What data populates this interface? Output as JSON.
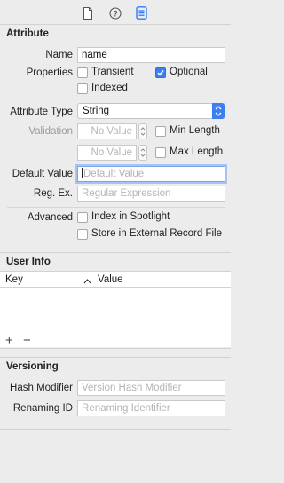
{
  "toolbar": {
    "tabs": [
      {
        "icon": "file-inspector-icon"
      },
      {
        "icon": "quick-help-icon"
      },
      {
        "icon": "data-model-inspector-icon"
      }
    ]
  },
  "attribute": {
    "header": "Attribute",
    "name_label": "Name",
    "name_value": "name",
    "properties_label": "Properties",
    "transient": {
      "label": "Transient",
      "checked": false
    },
    "optional": {
      "label": "Optional",
      "checked": true
    },
    "indexed": {
      "label": "Indexed",
      "checked": false
    },
    "type_label": "Attribute Type",
    "type_value": "String",
    "validation_label": "Validation",
    "min_placeholder": "No Value",
    "max_placeholder": "No Value",
    "min_length": {
      "label": "Min Length",
      "checked": false
    },
    "max_length": {
      "label": "Max Length",
      "checked": false
    },
    "default_label": "Default Value",
    "default_placeholder": "Default Value",
    "regex_label": "Reg. Ex.",
    "regex_placeholder": "Regular Expression",
    "advanced_label": "Advanced",
    "spotlight": {
      "label": "Index in Spotlight",
      "checked": false
    },
    "external": {
      "label": "Store in External Record File",
      "checked": false
    }
  },
  "user_info": {
    "header": "User Info",
    "col_key": "Key",
    "col_value": "Value",
    "add_symbol": "+",
    "remove_symbol": "−"
  },
  "versioning": {
    "header": "Versioning",
    "hash_label": "Hash Modifier",
    "hash_placeholder": "Version Hash Modifier",
    "renaming_label": "Renaming ID",
    "renaming_placeholder": "Renaming Identifier"
  },
  "colors": {
    "accent": "#3b7ff3",
    "background": "#ececec"
  }
}
